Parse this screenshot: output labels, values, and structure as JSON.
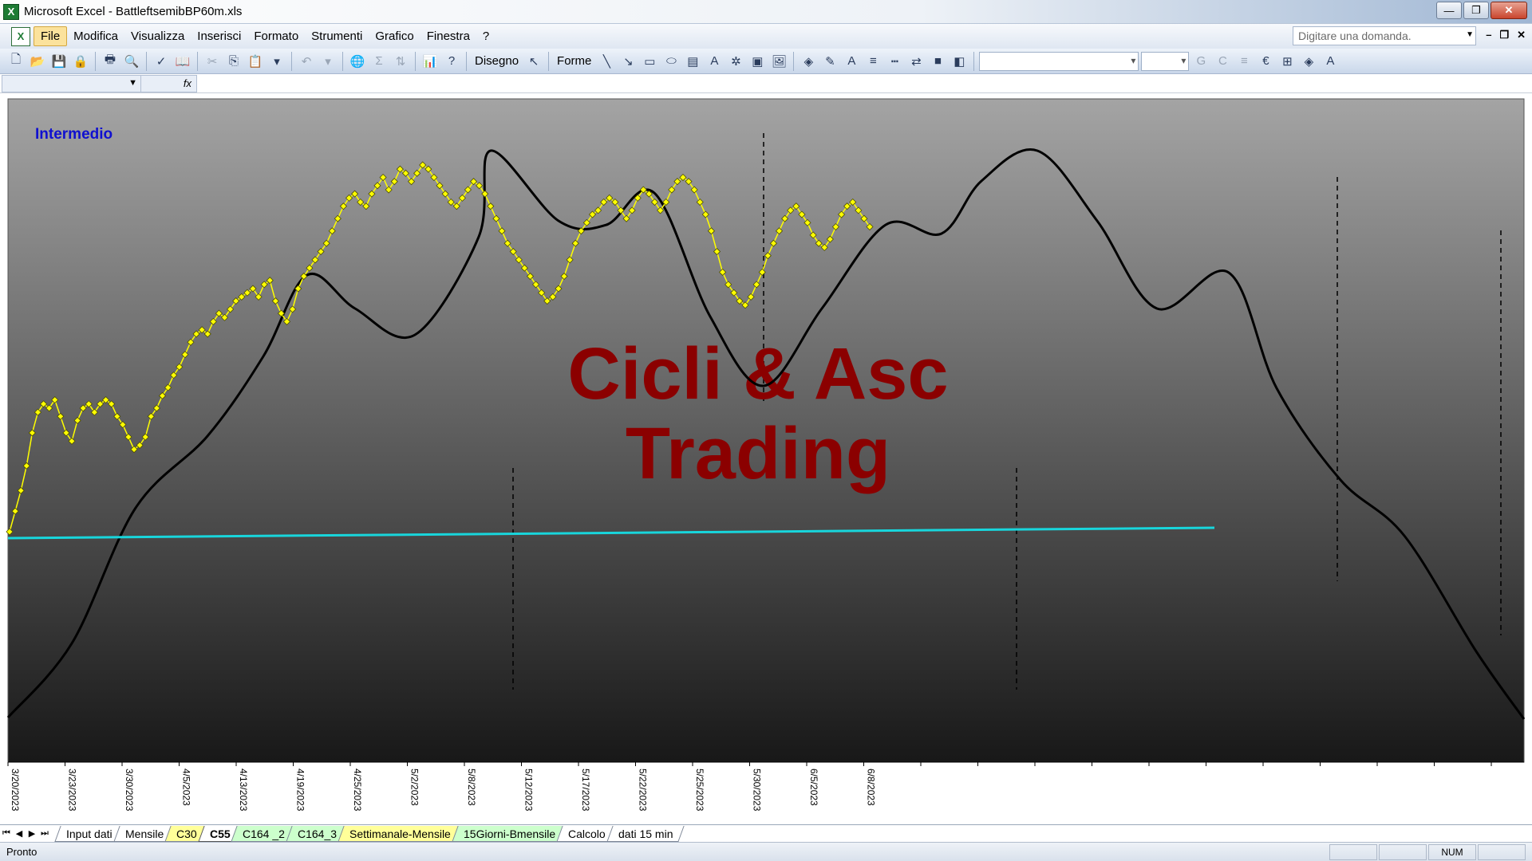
{
  "window": {
    "title": "Microsoft Excel - BattleftsemibBP60m.xls",
    "minimize": "—",
    "maximize": "❐",
    "close": "✕"
  },
  "menu": {
    "items": [
      "File",
      "Modifica",
      "Visualizza",
      "Inserisci",
      "Formato",
      "Strumenti",
      "Grafico",
      "Finestra",
      "?"
    ],
    "ask_placeholder": "Digitare una domanda."
  },
  "toolbar": {
    "disegno_label": "Disegno",
    "forme_label": "Forme",
    "bold_label": "G",
    "italic_label": "C",
    "euro_label": "€"
  },
  "formula_bar": {
    "fx_label": "fx"
  },
  "chart_data": {
    "type": "line",
    "subtitle": "Intermedio",
    "watermark": [
      "Cicli & Asc",
      "Trading"
    ],
    "x_tick_labels": [
      "3/20/2023",
      "3/23/2023",
      "3/30/2023",
      "4/5/2023",
      "4/13/2023",
      "4/19/2023",
      "4/25/2023",
      "5/2/2023",
      "5/8/2023",
      "5/12/2023",
      "5/17/2023",
      "5/22/2023",
      "5/25/2023",
      "5/30/2023",
      "6/5/2023",
      "6/8/2023"
    ],
    "background_gradient": [
      "#a4a4a4",
      "#181818"
    ],
    "colors": {
      "price": "#ffff00",
      "price_marker_stroke": "#4d4d00",
      "cycle": "#000000",
      "trend": "#18d6dc",
      "watermark": "#8b0000",
      "subtitle": "#1010d0"
    },
    "series": [
      {
        "name": "",
        "kind": "price",
        "values": [
          0.42,
          0.47,
          0.52,
          0.58,
          0.66,
          0.71,
          0.73,
          0.72,
          0.74,
          0.7,
          0.66,
          0.64,
          0.69,
          0.72,
          0.73,
          0.71,
          0.73,
          0.74,
          0.73,
          0.7,
          0.68,
          0.65,
          0.62,
          0.63,
          0.65,
          0.7,
          0.72,
          0.75,
          0.77,
          0.8,
          0.82,
          0.85,
          0.88,
          0.9,
          0.91,
          0.9,
          0.93,
          0.95,
          0.94,
          0.96,
          0.98,
          0.99,
          1.0,
          1.01,
          0.99,
          1.02,
          1.03,
          0.98,
          0.95,
          0.93,
          0.96,
          1.01,
          1.04,
          1.06,
          1.08,
          1.1,
          1.12,
          1.15,
          1.18,
          1.21,
          1.23,
          1.24,
          1.22,
          1.21,
          1.24,
          1.26,
          1.28,
          1.25,
          1.27,
          1.3,
          1.29,
          1.27,
          1.29,
          1.31,
          1.3,
          1.28,
          1.26,
          1.24,
          1.22,
          1.21,
          1.23,
          1.25,
          1.27,
          1.26,
          1.24,
          1.21,
          1.18,
          1.15,
          1.12,
          1.1,
          1.08,
          1.06,
          1.04,
          1.02,
          1.0,
          0.98,
          0.99,
          1.01,
          1.04,
          1.08,
          1.12,
          1.15,
          1.17,
          1.19,
          1.2,
          1.22,
          1.23,
          1.22,
          1.2,
          1.18,
          1.2,
          1.23,
          1.25,
          1.24,
          1.22,
          1.2,
          1.22,
          1.25,
          1.27,
          1.28,
          1.27,
          1.25,
          1.22,
          1.19,
          1.15,
          1.1,
          1.05,
          1.02,
          1.0,
          0.98,
          0.97,
          0.99,
          1.02,
          1.05,
          1.09,
          1.12,
          1.15,
          1.18,
          1.2,
          1.21,
          1.19,
          1.17,
          1.14,
          1.12,
          1.11,
          1.13,
          1.16,
          1.19,
          1.21,
          1.22,
          1.2,
          1.18,
          1.16
        ],
        "note_points_count": 0
      },
      {
        "name": "",
        "kind": "cycle",
        "values": []
      },
      {
        "name": "",
        "kind": "trend",
        "values": []
      }
    ]
  },
  "sheet_tabs": [
    {
      "label": "Input dati",
      "color": "white"
    },
    {
      "label": "Mensile",
      "color": "white"
    },
    {
      "label": "C30",
      "color": "yellow"
    },
    {
      "label": "C55",
      "color": "active"
    },
    {
      "label": "C164 _2",
      "color": "green"
    },
    {
      "label": "C164_3",
      "color": "green"
    },
    {
      "label": "Settimanale-Mensile",
      "color": "yellow"
    },
    {
      "label": "15Giorni-Bmensile",
      "color": "green"
    },
    {
      "label": "Calcolo",
      "color": "white"
    },
    {
      "label": "dati 15 min",
      "color": "white"
    }
  ],
  "status": {
    "text": "Pronto",
    "num": "NUM"
  }
}
